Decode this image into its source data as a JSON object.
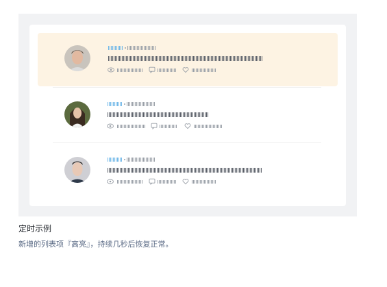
{
  "demo": {
    "items": [
      {
        "highlighted": true,
        "avatar": "man-portrait"
      },
      {
        "highlighted": false,
        "avatar": "woman-portrait"
      },
      {
        "highlighted": false,
        "avatar": "man-portrait-2"
      }
    ],
    "stat_icons": [
      "eye-icon",
      "comment-icon",
      "heart-icon"
    ]
  },
  "caption": {
    "title": "定时示例",
    "description": "新增的列表项『高亮』，持续几秒后恢复正常。"
  },
  "colors": {
    "highlight_bg": "#fdf3e3",
    "name_accent": "#6fb7e8",
    "panel_bg": "#f1f2f4"
  }
}
